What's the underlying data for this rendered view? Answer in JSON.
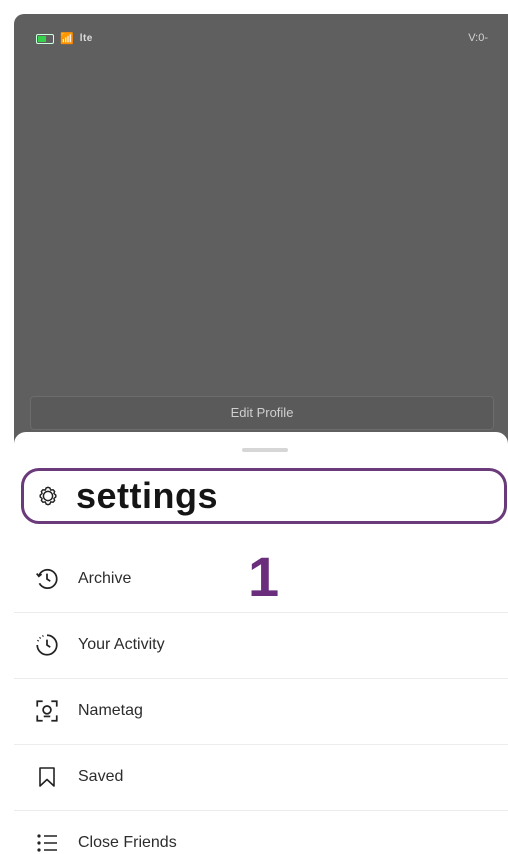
{
  "status_bar": {
    "carrier": "lte",
    "right_text": "V:0-"
  },
  "profile": {
    "edit_profile_label": "Edit Profile"
  },
  "menu": {
    "items": [
      {
        "label": "settings",
        "icon": "gear-icon"
      },
      {
        "label": "Archive",
        "icon": "archive-clock-icon"
      },
      {
        "label": "Your Activity",
        "icon": "activity-icon"
      },
      {
        "label": "Nametag",
        "icon": "nametag-scan-icon"
      },
      {
        "label": "Saved",
        "icon": "bookmark-icon"
      },
      {
        "label": "Close Friends",
        "icon": "list-icon"
      }
    ]
  },
  "annotation": {
    "number": "1",
    "color": "#6b2e7c"
  }
}
